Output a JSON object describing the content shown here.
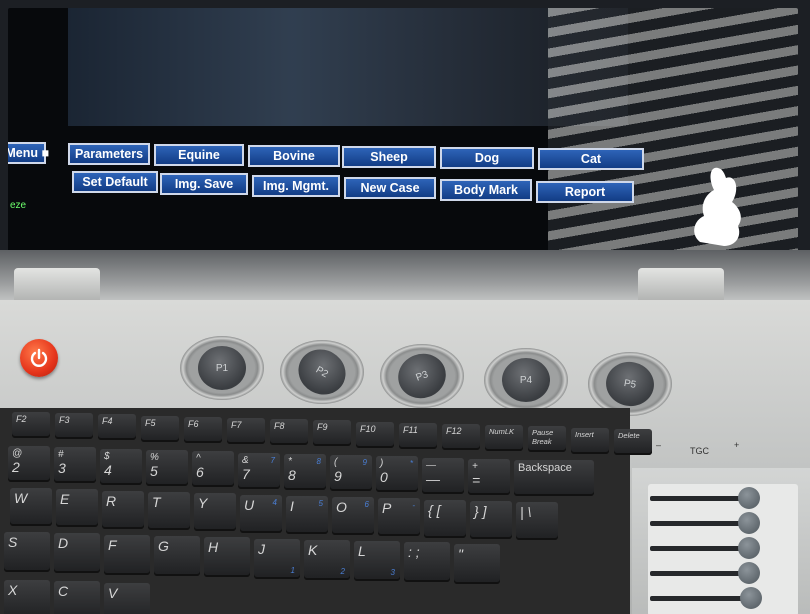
{
  "screen": {
    "menu": {
      "row1": [
        "e Menu ■",
        "Parameters",
        "Equine",
        "Bovine",
        "Sheep",
        "Dog",
        "Cat"
      ],
      "row2": [
        "Set Default",
        "Img. Save",
        "Img. Mgmt.",
        "New Case",
        "Body Mark",
        "Report"
      ]
    },
    "status_text": "eze",
    "species_icon": "rabbit-icon"
  },
  "knobs": [
    "P1",
    "P2",
    "P3",
    "P4",
    "P5"
  ],
  "power_icon": "power-icon",
  "keyboard": {
    "fkeys": [
      "F2",
      "F3",
      "F4",
      "F5",
      "F6",
      "F7",
      "F8",
      "F9",
      "F10",
      "F11",
      "F12",
      "NumLK",
      "Pause Break",
      "Insert",
      "Delete"
    ],
    "num_row": [
      {
        "top": "@",
        "main": "2"
      },
      {
        "top": "#",
        "main": "3"
      },
      {
        "top": "$",
        "main": "4"
      },
      {
        "top": "%",
        "main": "5"
      },
      {
        "top": "^",
        "main": "6"
      },
      {
        "top": "&",
        "main": "7",
        "sub": "7"
      },
      {
        "top": "*",
        "main": "8",
        "sub": "8"
      },
      {
        "top": "(",
        "main": "9",
        "sub": "9"
      },
      {
        "top": ")",
        "main": "0",
        "sub": "*"
      },
      {
        "top": "—",
        "main": "—"
      },
      {
        "top": "+",
        "main": "="
      },
      {
        "main": "Backspace"
      }
    ],
    "row_w": [
      "W",
      "E",
      "R",
      "T",
      "Y",
      "U",
      "I",
      "O",
      "P",
      "{ [",
      "} ]",
      "| \\"
    ],
    "row_w_sub": {
      "U": "4",
      "I": "5",
      "O": "6",
      "P": "-"
    },
    "row_s": [
      "S",
      "D",
      "F",
      "G",
      "H",
      "J",
      "K",
      "L",
      ": ;",
      "\""
    ],
    "row_s_sub": {
      "J": "1",
      "K": "2",
      "L": "3"
    },
    "row_x": [
      "X",
      "C",
      "V"
    ]
  },
  "tgc": {
    "label": "TGC",
    "minus": "–",
    "plus": "+",
    "sliders": 5
  }
}
